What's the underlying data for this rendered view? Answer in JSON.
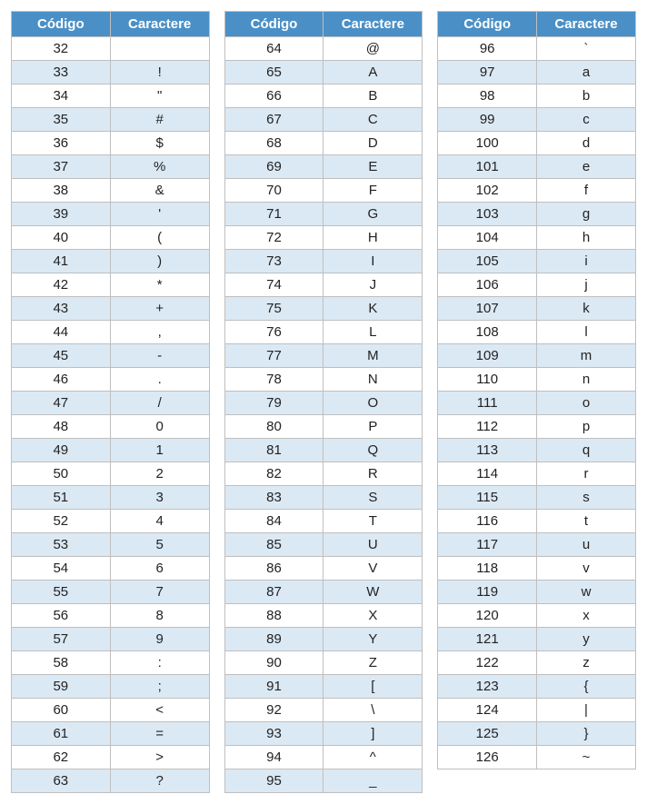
{
  "headers": {
    "code": "Código",
    "char": "Caractere"
  },
  "columns": [
    {
      "rows": [
        {
          "code": "32",
          "char": ""
        },
        {
          "code": "33",
          "char": "!"
        },
        {
          "code": "34",
          "char": "\""
        },
        {
          "code": "35",
          "char": "#"
        },
        {
          "code": "36",
          "char": "$"
        },
        {
          "code": "37",
          "char": "%"
        },
        {
          "code": "38",
          "char": "&"
        },
        {
          "code": "39",
          "char": "'"
        },
        {
          "code": "40",
          "char": "("
        },
        {
          "code": "41",
          "char": ")"
        },
        {
          "code": "42",
          "char": "*"
        },
        {
          "code": "43",
          "char": "+"
        },
        {
          "code": "44",
          "char": ","
        },
        {
          "code": "45",
          "char": "-"
        },
        {
          "code": "46",
          "char": "."
        },
        {
          "code": "47",
          "char": "/"
        },
        {
          "code": "48",
          "char": "0"
        },
        {
          "code": "49",
          "char": "1"
        },
        {
          "code": "50",
          "char": "2"
        },
        {
          "code": "51",
          "char": "3"
        },
        {
          "code": "52",
          "char": "4"
        },
        {
          "code": "53",
          "char": "5"
        },
        {
          "code": "54",
          "char": "6"
        },
        {
          "code": "55",
          "char": "7"
        },
        {
          "code": "56",
          "char": "8"
        },
        {
          "code": "57",
          "char": "9"
        },
        {
          "code": "58",
          "char": ":"
        },
        {
          "code": "59",
          "char": ";"
        },
        {
          "code": "60",
          "char": "<"
        },
        {
          "code": "61",
          "char": "="
        },
        {
          "code": "62",
          "char": ">"
        },
        {
          "code": "63",
          "char": "?"
        }
      ]
    },
    {
      "rows": [
        {
          "code": "64",
          "char": "@"
        },
        {
          "code": "65",
          "char": "A"
        },
        {
          "code": "66",
          "char": "B"
        },
        {
          "code": "67",
          "char": "C"
        },
        {
          "code": "68",
          "char": "D"
        },
        {
          "code": "69",
          "char": "E"
        },
        {
          "code": "70",
          "char": "F"
        },
        {
          "code": "71",
          "char": "G"
        },
        {
          "code": "72",
          "char": "H"
        },
        {
          "code": "73",
          "char": "I"
        },
        {
          "code": "74",
          "char": "J"
        },
        {
          "code": "75",
          "char": "K"
        },
        {
          "code": "76",
          "char": "L"
        },
        {
          "code": "77",
          "char": "M"
        },
        {
          "code": "78",
          "char": "N"
        },
        {
          "code": "79",
          "char": "O"
        },
        {
          "code": "80",
          "char": "P"
        },
        {
          "code": "81",
          "char": "Q"
        },
        {
          "code": "82",
          "char": "R"
        },
        {
          "code": "83",
          "char": "S"
        },
        {
          "code": "84",
          "char": "T"
        },
        {
          "code": "85",
          "char": "U"
        },
        {
          "code": "86",
          "char": "V"
        },
        {
          "code": "87",
          "char": "W"
        },
        {
          "code": "88",
          "char": "X"
        },
        {
          "code": "89",
          "char": "Y"
        },
        {
          "code": "90",
          "char": "Z"
        },
        {
          "code": "91",
          "char": "["
        },
        {
          "code": "92",
          "char": "\\"
        },
        {
          "code": "93",
          "char": "]"
        },
        {
          "code": "94",
          "char": "^"
        },
        {
          "code": "95",
          "char": "_"
        }
      ]
    },
    {
      "rows": [
        {
          "code": "96",
          "char": "`"
        },
        {
          "code": "97",
          "char": "a"
        },
        {
          "code": "98",
          "char": "b"
        },
        {
          "code": "99",
          "char": "c"
        },
        {
          "code": "100",
          "char": "d"
        },
        {
          "code": "101",
          "char": "e"
        },
        {
          "code": "102",
          "char": "f"
        },
        {
          "code": "103",
          "char": "g"
        },
        {
          "code": "104",
          "char": "h"
        },
        {
          "code": "105",
          "char": "i"
        },
        {
          "code": "106",
          "char": "j"
        },
        {
          "code": "107",
          "char": "k"
        },
        {
          "code": "108",
          "char": "l"
        },
        {
          "code": "109",
          "char": "m"
        },
        {
          "code": "110",
          "char": "n"
        },
        {
          "code": "111",
          "char": "o"
        },
        {
          "code": "112",
          "char": "p"
        },
        {
          "code": "113",
          "char": "q"
        },
        {
          "code": "114",
          "char": "r"
        },
        {
          "code": "115",
          "char": "s"
        },
        {
          "code": "116",
          "char": "t"
        },
        {
          "code": "117",
          "char": "u"
        },
        {
          "code": "118",
          "char": "v"
        },
        {
          "code": "119",
          "char": "w"
        },
        {
          "code": "120",
          "char": "x"
        },
        {
          "code": "121",
          "char": "y"
        },
        {
          "code": "122",
          "char": "z"
        },
        {
          "code": "123",
          "char": "{"
        },
        {
          "code": "124",
          "char": "|"
        },
        {
          "code": "125",
          "char": "}"
        },
        {
          "code": "126",
          "char": "~"
        }
      ]
    }
  ]
}
